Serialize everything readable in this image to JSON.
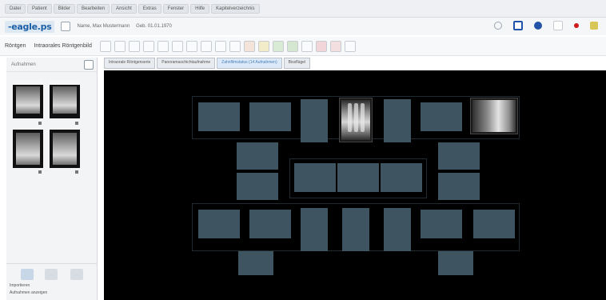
{
  "menu": [
    "Datei",
    "Patient",
    "Bilder",
    "Bearbeiten",
    "Ansicht",
    "Extras",
    "Fenster",
    "Hilfe",
    "Kapitelverzeichnis"
  ],
  "toolbar": {
    "logo": "-eagle.ps",
    "patient_label": "Name, Max Mustermann",
    "patient_info": "Geb. 01.01.1970"
  },
  "toolbar2": {
    "label1": "Röntgen",
    "label2": "Intraorales Röntgenbild"
  },
  "left_panel": {
    "header": "Aufnahmen",
    "footer_label1": "Importieren",
    "footer_label2": "Aufnahmen anzeigen"
  },
  "tabs": [
    {
      "label": "Intraorale Röntgenserie"
    },
    {
      "label": "Panoramaschichtaufnahme"
    },
    {
      "label": "Zahnfilmstatus (14 Aufnahmen)",
      "active": true
    },
    {
      "label": "Bissflügel"
    }
  ],
  "colors": {
    "slot": "#3e5461",
    "canvas": "#000000",
    "accent": "#1b5fa6"
  }
}
